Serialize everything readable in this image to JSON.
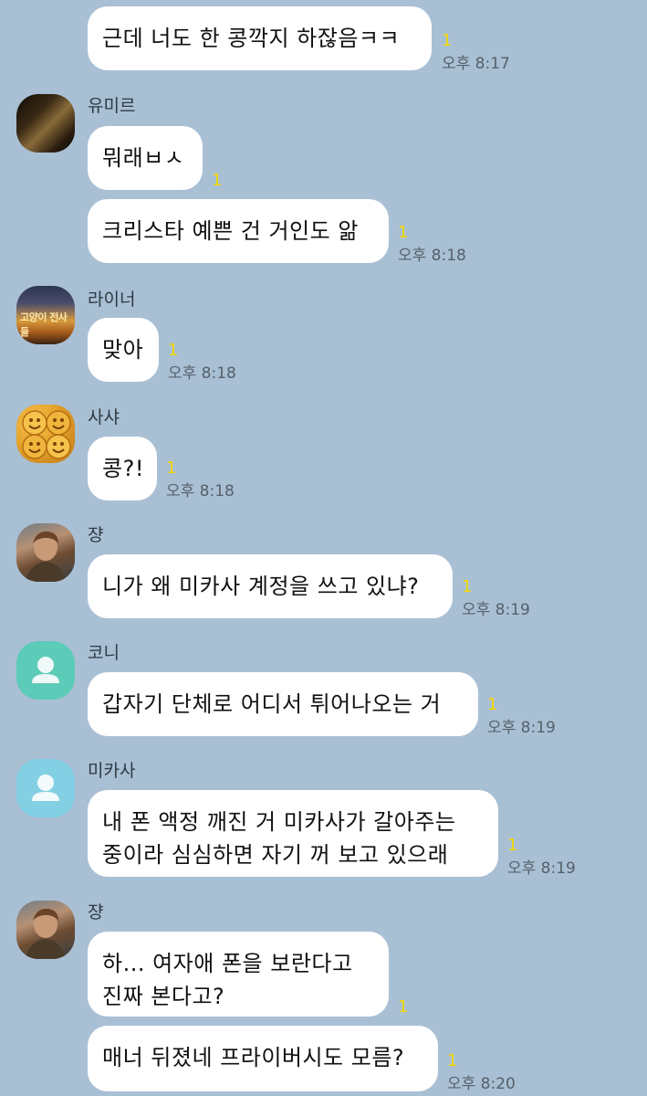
{
  "messages": [
    {
      "text": "근데 너도 한 콩깍지 하잖음ㅋㅋ",
      "unread": "1",
      "time": "오후 8:17"
    },
    {
      "sender": "유미르",
      "text": "뭐래ㅂㅅ",
      "unread": "1"
    },
    {
      "text": "크리스타 예쁜 건 거인도 앎",
      "unread": "1",
      "time": "오후 8:18"
    },
    {
      "sender": "라이너",
      "text": "맞아",
      "unread": "1",
      "time": "오후 8:18"
    },
    {
      "sender": "사샤",
      "text": "콩?!",
      "unread": "1",
      "time": "오후 8:18"
    },
    {
      "sender": "쟝",
      "text": "니가 왜 미카사 계정을 쓰고 있냐?",
      "unread": "1",
      "time": "오후 8:19"
    },
    {
      "sender": "코니",
      "text": "갑자기 단체로 어디서 튀어나오는 거",
      "unread": "1",
      "time": "오후 8:19"
    },
    {
      "sender": "미카사",
      "text": "내 폰 액정 깨진 거 미카사가 갈아주는\n중이라 심심하면 자기 꺼 보고 있으래",
      "unread": "1",
      "time": "오후 8:19"
    },
    {
      "sender": "쟝",
      "text": "하... 여자애 폰을 보란다고\n진짜 본다고?",
      "unread": "1"
    },
    {
      "text": "매너 뒤졌네 프라이버시도 모름?",
      "unread": "1",
      "time": "오후 8:20"
    }
  ],
  "avatars": {
    "ymir": "ymir-avatar",
    "reiner": "reiner-avatar",
    "reiner_caption": "고양이 전사들",
    "sasha": "sasha-avatar",
    "jean": "jean-avatar",
    "connie": "default-person-icon",
    "mikasa": "default-person-icon"
  },
  "colors": {
    "background": "#a9bfd4",
    "bubble": "#ffffff",
    "unread": "#f3d800",
    "default_avatar_connie": "#5ccbb8",
    "default_avatar_mikasa": "#83d0e4"
  }
}
